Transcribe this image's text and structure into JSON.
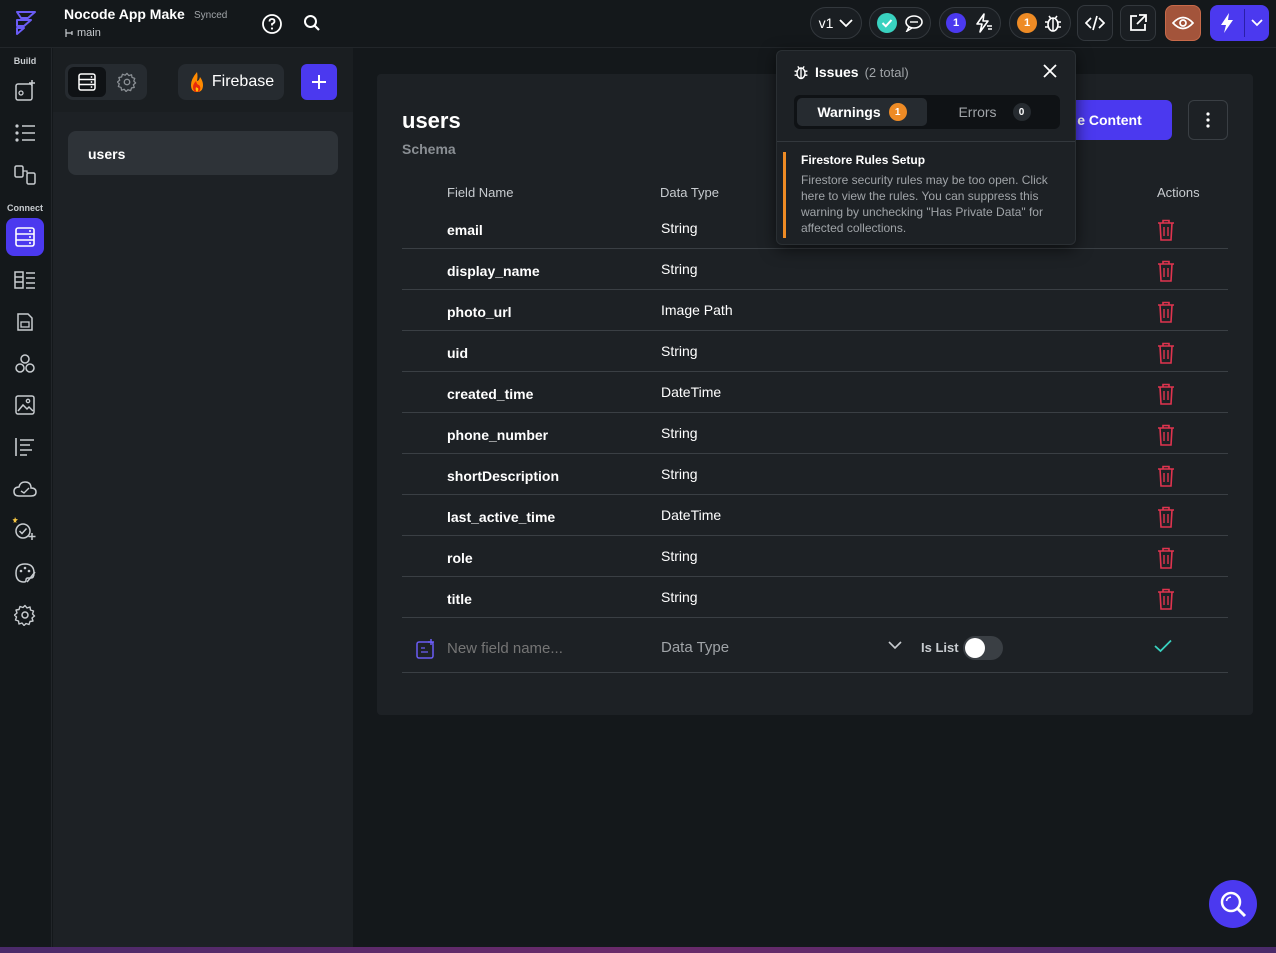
{
  "header": {
    "app_title": "Nocode App Make",
    "sync_status": "Synced",
    "branch": "main",
    "version": "v1",
    "comments_badge": "1",
    "issues_badge": "1"
  },
  "rail": {
    "build_label": "Build",
    "connect_label": "Connect"
  },
  "collections": {
    "provider": "Firebase",
    "items": [
      {
        "label": "users"
      }
    ]
  },
  "schema": {
    "title": "users",
    "subtitle": "Schema",
    "manage_label": "e Content",
    "columns": {
      "field_name": "Field Name",
      "data_type": "Data Type",
      "actions": "Actions"
    },
    "fields": [
      {
        "name": "email",
        "type": "String"
      },
      {
        "name": "display_name",
        "type": "String"
      },
      {
        "name": "photo_url",
        "type": "Image Path"
      },
      {
        "name": "uid",
        "type": "String"
      },
      {
        "name": "created_time",
        "type": "DateTime"
      },
      {
        "name": "phone_number",
        "type": "String"
      },
      {
        "name": "shortDescription",
        "type": "String"
      },
      {
        "name": "last_active_time",
        "type": "DateTime"
      },
      {
        "name": "role",
        "type": "String"
      },
      {
        "name": "title",
        "type": "String"
      }
    ],
    "new_field": {
      "placeholder": "New field name...",
      "type_placeholder": "Data Type",
      "is_list_label": "Is List",
      "is_list": false
    }
  },
  "issues": {
    "title": "Issues",
    "count": "(2 total)",
    "warnings_label": "Warnings",
    "warnings_count": "1",
    "errors_label": "Errors",
    "errors_count": "0",
    "item_title": "Firestore Rules Setup",
    "item_body": "Firestore security rules may be too open. Click here to view the rules. You can suppress this warning by unchecking \"Has Private Data\" for affected collections."
  },
  "colors": {
    "accent": "#4b39ef",
    "warning": "#ee8b25",
    "danger": "#e0344f",
    "success": "#39d2c0"
  }
}
